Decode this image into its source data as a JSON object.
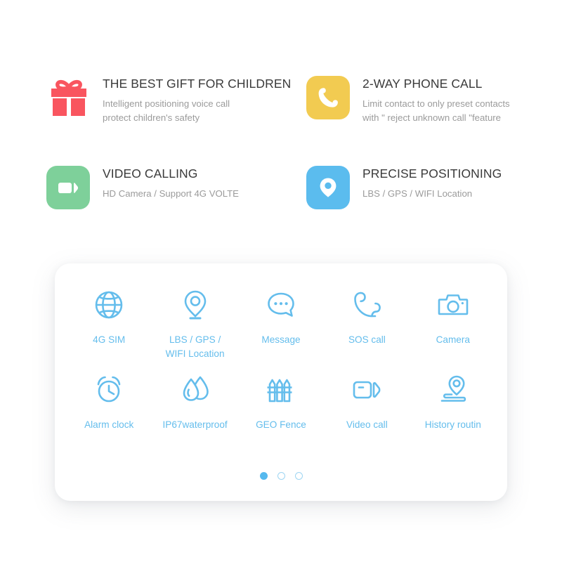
{
  "colors": {
    "gift_red": "#f9555f",
    "phone_yellow": "#f2cb51",
    "video_green": "#7ed09a",
    "location_blue": "#5bbcee",
    "grid_blue": "#64bdec",
    "dot_active": "#56b9ee",
    "dot_inactive_border": "#9ed5f2",
    "title_text": "#3a3a3a",
    "desc_text": "#9b9b9b",
    "background": "#ffffff"
  },
  "features": [
    {
      "icon": "gift-icon",
      "title": "THE BEST GIFT FOR CHILDREN",
      "desc_line1": "Intelligent positioning voice call",
      "desc_line2": "protect children's safety"
    },
    {
      "icon": "phone-call-icon",
      "title": "2-WAY PHONE CALL",
      "desc_line1": "Limit contact to only preset contacts",
      "desc_line2": "with \" reject unknown call \"feature"
    },
    {
      "icon": "video-camera-icon",
      "title": "VIDEO CALLING",
      "desc_line1": "HD Camera / Support 4G VOLTE",
      "desc_line2": ""
    },
    {
      "icon": "location-pin-icon",
      "title": "PRECISE POSITIONING",
      "desc_line1": "LBS / GPS /  WIFI Location",
      "desc_line2": ""
    }
  ],
  "grid": {
    "items": [
      {
        "icon": "globe-icon",
        "label_line1": "4G SIM",
        "label_line2": ""
      },
      {
        "icon": "map-pin-icon",
        "label_line1": "LBS / GPS /",
        "label_line2": "WIFI Location"
      },
      {
        "icon": "chat-bubble-icon",
        "label_line1": "Message",
        "label_line2": ""
      },
      {
        "icon": "phone-handset-icon",
        "label_line1": "SOS call",
        "label_line2": ""
      },
      {
        "icon": "camera-icon",
        "label_line1": "Camera",
        "label_line2": ""
      },
      {
        "icon": "alarm-clock-icon",
        "label_line1": "Alarm clock",
        "label_line2": ""
      },
      {
        "icon": "water-drop-icon",
        "label_line1": "IP67waterproof",
        "label_line2": ""
      },
      {
        "icon": "fence-icon",
        "label_line1": "GEO Fence",
        "label_line2": ""
      },
      {
        "icon": "video-call-icon",
        "label_line1": "Video call",
        "label_line2": ""
      },
      {
        "icon": "route-history-icon",
        "label_line1": "History routin",
        "label_line2": ""
      }
    ],
    "pagination": {
      "count": 3,
      "active_index": 0
    }
  }
}
